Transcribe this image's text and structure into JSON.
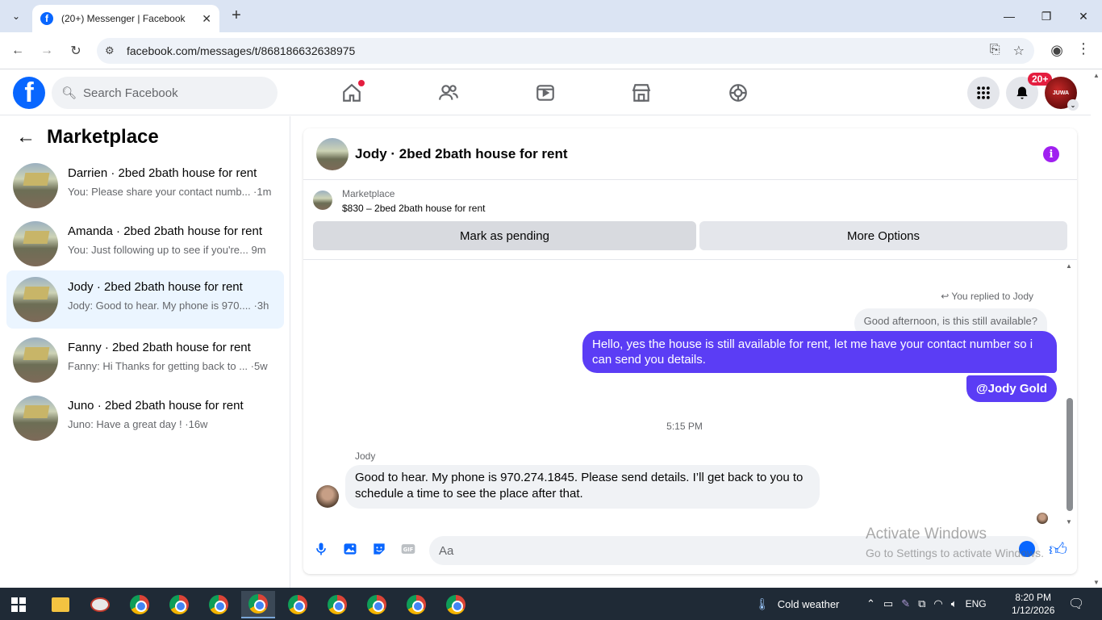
{
  "browser": {
    "tab_title": "(20+) Messenger | Facebook",
    "url": "facebook.com/messages/t/868186632638975"
  },
  "fb": {
    "search_placeholder": "Search Facebook",
    "notification_badge": "20+",
    "profile_avatar_text": "JUWA"
  },
  "left": {
    "title": "Marketplace",
    "conversations": [
      {
        "name": "Darrien · 2bed 2bath house for rent",
        "preview": "You: Please share your contact numb... ·1m",
        "active": false
      },
      {
        "name": "Amanda · 2bed 2bath house for rent",
        "preview": "You: Just following up to see if you're... 9m",
        "active": false
      },
      {
        "name": "Jody · 2bed 2bath house for rent",
        "preview": "Jody: Good to hear. My phone is 970.... ·3h",
        "active": true
      },
      {
        "name": "Fanny · 2bed 2bath house for rent",
        "preview": "Fanny: Hi Thanks for getting back to ... ·5w",
        "active": false
      },
      {
        "name": "Juno · 2bed 2bath house for rent",
        "preview": "Juno: Have a great day ! ·16w",
        "active": false
      }
    ]
  },
  "chat": {
    "title": "Jody · 2bed 2bath house for rent",
    "marketplace_label": "Marketplace",
    "listing": "$830 – 2bed 2bath house for rent",
    "mark_pending": "Mark as pending",
    "more_options": "More Options",
    "replied_to": "You replied to Jody",
    "quoted": "Good afternoon, is this still available?",
    "out_message": "Hello, yes the house is still available for rent, let me have your contact number so i can send you details.",
    "mention": "@Jody Gold",
    "time": "5:15 PM",
    "sender": "Jody",
    "in_message": "Good to hear. My phone is 970.274.1845. Please send details. I’ll get back to you to schedule a time to see the place after that.",
    "composer_placeholder": "Aa"
  },
  "watermark": {
    "line1": "Activate Windows",
    "line2": "Go to Settings to activate Windows."
  },
  "taskbar": {
    "weather": "Cold weather",
    "lang": "ENG",
    "time": "8:20 PM",
    "date": "1/12/2026"
  }
}
